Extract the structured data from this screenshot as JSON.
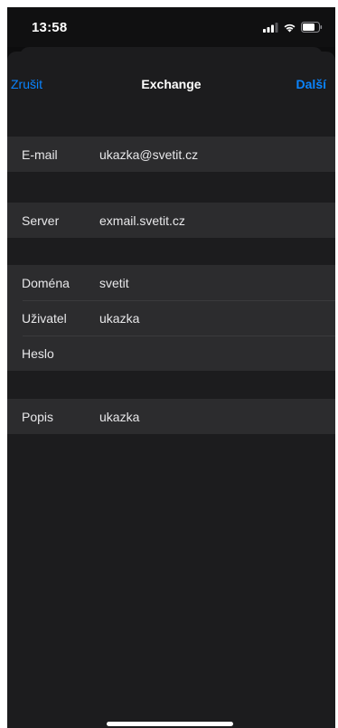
{
  "status_bar": {
    "time": "13:58",
    "icons": [
      "cellular-signal-icon",
      "wifi-icon",
      "battery-icon"
    ]
  },
  "nav": {
    "cancel_label": "Zrušit",
    "title": "Exchange",
    "next_label": "Další"
  },
  "form": {
    "email": {
      "label": "E-mail",
      "value": "ukazka@svetit.cz"
    },
    "server": {
      "label": "Server",
      "value": "exmail.svetit.cz"
    },
    "domain": {
      "label": "Doména",
      "value": "svetit"
    },
    "user": {
      "label": "Uživatel",
      "value": "ukazka"
    },
    "password": {
      "label": "Heslo",
      "value": ""
    },
    "description": {
      "label": "Popis",
      "value": "ukazka"
    }
  },
  "colors": {
    "background": "#1c1c1e",
    "cell": "#2c2c2e",
    "accent": "#0a84ff",
    "text": "#e8e8ea"
  }
}
